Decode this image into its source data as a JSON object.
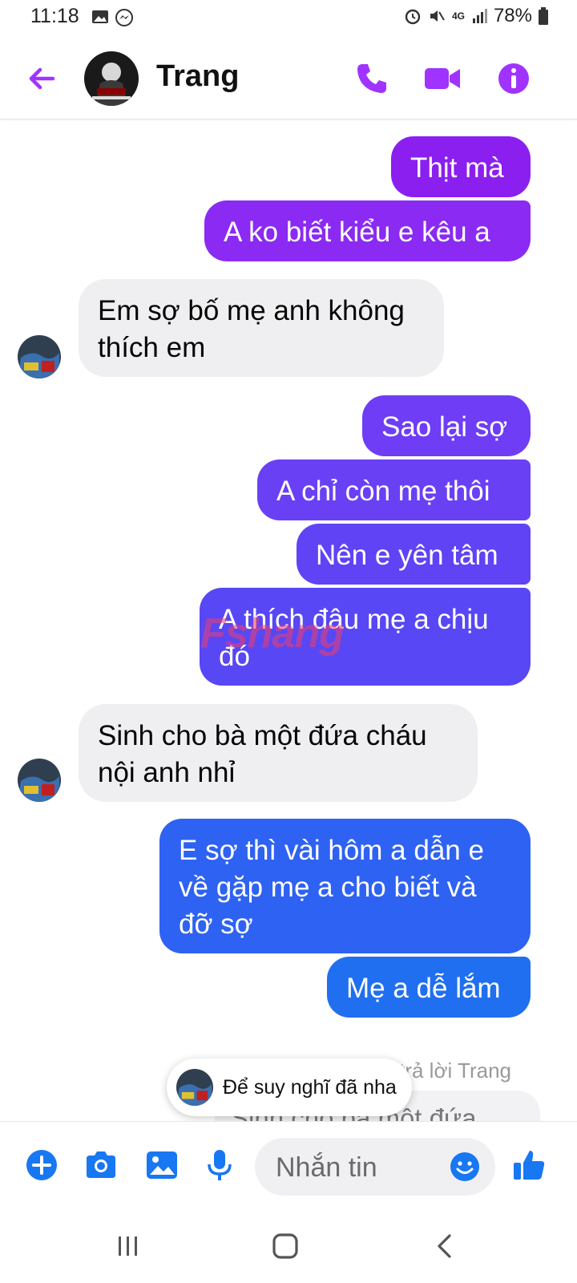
{
  "status_bar": {
    "time": "11:18",
    "battery": "78%",
    "network": "4G"
  },
  "header": {
    "contact_name": "Trang"
  },
  "messages": [
    {
      "dir": "out",
      "text": "Thịt mà",
      "color": "#8a1ff0"
    },
    {
      "dir": "out",
      "text": "A ko biết kiểu e kêu a",
      "color": "#8b2af2"
    },
    {
      "dir": "in",
      "text": "Em sợ bố mẹ anh không thích em"
    },
    {
      "dir": "out",
      "text": "Sao lại sợ",
      "color": "#6e3df5"
    },
    {
      "dir": "out",
      "text": "A chỉ còn mẹ thôi",
      "color": "#6a40f5"
    },
    {
      "dir": "out",
      "text": "Nên e yên tâm",
      "color": "#6043f4"
    },
    {
      "dir": "out",
      "text": "A thích đâu mẹ a chịu đó",
      "color": "#5847f4"
    },
    {
      "dir": "in",
      "text": "Sinh cho bà một đứa cháu nội anh nhỉ"
    },
    {
      "dir": "out",
      "text": "E sợ thì vài hôm a dẫn e về gặp mẹ a cho biết và đỡ sợ",
      "color": "#2e62f2"
    },
    {
      "dir": "out",
      "text": "Mẹ a dễ lắm",
      "color": "#1f6ff0"
    }
  ],
  "reply": {
    "label": "trả lời Trang",
    "quote": "Sinh cho bà một đứa"
  },
  "toast": {
    "text": "Để suy nghĩ đã nha"
  },
  "composer": {
    "placeholder": "Nhắn tin"
  },
  "watermark": {
    "text": "Fshang"
  },
  "colors": {
    "accent": "#a033ff",
    "blue": "#1877f2"
  }
}
